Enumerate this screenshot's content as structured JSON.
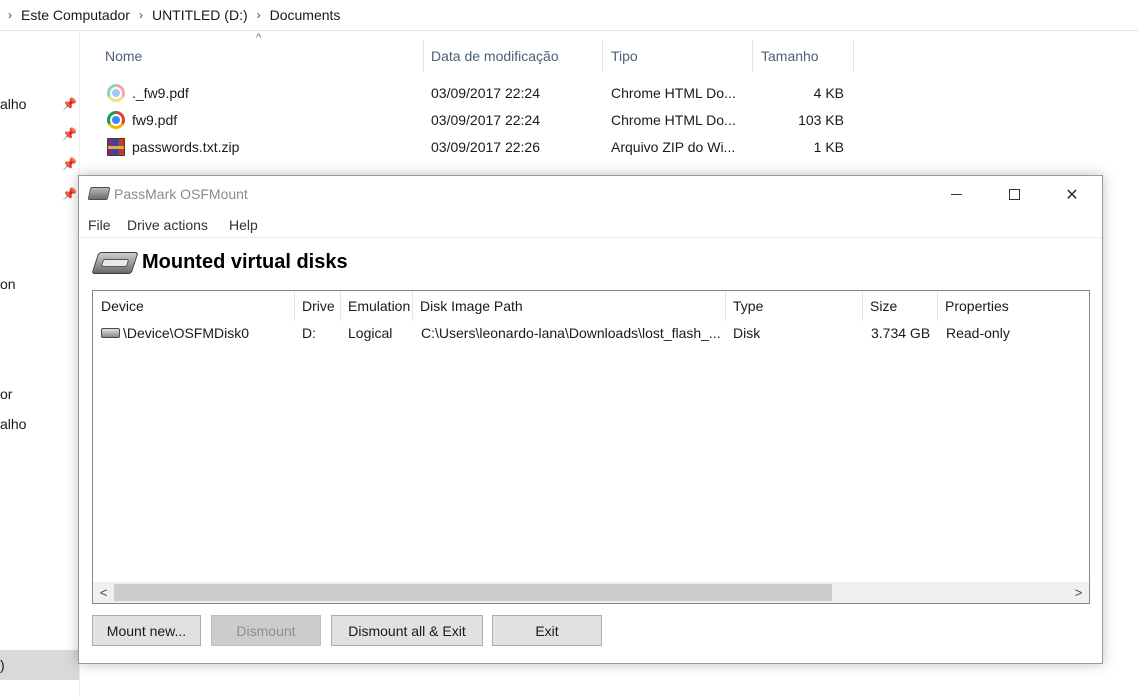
{
  "breadcrumb": {
    "items": [
      "Este Computador",
      "UNTITLED (D:)",
      "Documents"
    ]
  },
  "nav_pane": {
    "items": [
      "alho",
      "on",
      "or",
      "alho"
    ],
    "selected_label": ")"
  },
  "explorer": {
    "columns": {
      "name": "Nome",
      "modified": "Data de modificação",
      "type": "Tipo",
      "size": "Tamanho"
    },
    "sort_indicator": "^",
    "files": [
      {
        "name": "._fw9.pdf",
        "modified": "03/09/2017 22:24",
        "type": "Chrome HTML Do...",
        "size": "4 KB",
        "icon": "chrome-file-icon"
      },
      {
        "name": "fw9.pdf",
        "modified": "03/09/2017 22:24",
        "type": "Chrome HTML Do...",
        "size": "103 KB",
        "icon": "chrome-file-icon"
      },
      {
        "name": "passwords.txt.zip",
        "modified": "03/09/2017 22:26",
        "type": "Arquivo ZIP do Wi...",
        "size": "1 KB",
        "icon": "winrar-archive-icon"
      }
    ]
  },
  "window": {
    "title": "PassMark OSFMount",
    "menu": [
      "File",
      "Drive actions",
      "Help"
    ],
    "header_title": "Mounted virtual disks",
    "list_columns": [
      "Device",
      "Drive",
      "Emulation",
      "Disk Image Path",
      "Type",
      "Size",
      "Properties"
    ],
    "disks": [
      {
        "device": "\\Device\\OSFMDisk0",
        "drive": "D:",
        "emulation": "Logical",
        "path": "C:\\Users\\leonardo-lana\\Downloads\\lost_flash_...",
        "type": "Disk",
        "size": "3.734 GB",
        "properties": "Read-only"
      }
    ],
    "buttons": {
      "mount_new": "Mount new...",
      "dismount": "Dismount",
      "dismount_all_exit": "Dismount all & Exit",
      "exit": "Exit"
    },
    "scroll_left": "<",
    "scroll_right": ">",
    "close_glyph": "✕"
  },
  "colors": {
    "column_header_text": "#4c607a",
    "disabled_button": "#cccccc",
    "selected_nav": "#d9d9d9"
  }
}
